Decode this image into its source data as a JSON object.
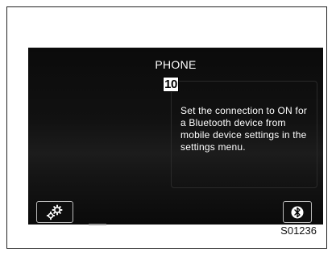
{
  "screen": {
    "title": "PHONE",
    "message": "Set the connection to ON for a Bluetooth device from mobile device settings in the settings menu."
  },
  "callout": {
    "number": "10"
  },
  "buttons": {
    "settings_icon": "gears-icon",
    "bluetooth_icon": "bluetooth-icon"
  },
  "figure": {
    "code": "S01236"
  }
}
